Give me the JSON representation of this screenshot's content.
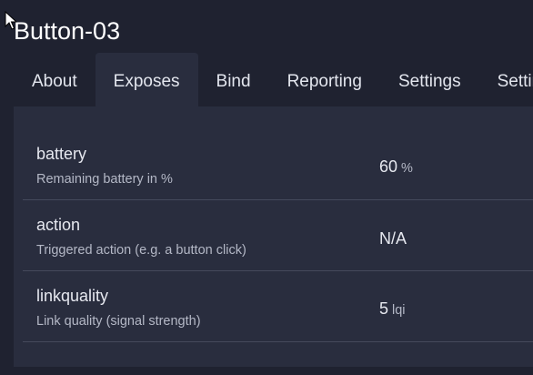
{
  "device": {
    "title": "Button-03"
  },
  "tabs": [
    {
      "label": "About"
    },
    {
      "label": "Exposes",
      "active": true
    },
    {
      "label": "Bind"
    },
    {
      "label": "Reporting"
    },
    {
      "label": "Settings"
    },
    {
      "label": "Settings"
    }
  ],
  "exposes": [
    {
      "name": "battery",
      "description": "Remaining battery in %",
      "value": "60",
      "unit": "%"
    },
    {
      "name": "action",
      "description": "Triggered action (e.g. a button click)",
      "value": "N/A",
      "unit": ""
    },
    {
      "name": "linkquality",
      "description": "Link quality (signal strength)",
      "value": "5",
      "unit": "lqi"
    }
  ],
  "colors": {
    "background": "#1f2230",
    "panel": "#292d3e",
    "divider": "#454a5c",
    "text": "#e6e8ef",
    "muted_text": "#b4b8c6"
  },
  "icons": {
    "cursor": "mouse-pointer-icon"
  }
}
